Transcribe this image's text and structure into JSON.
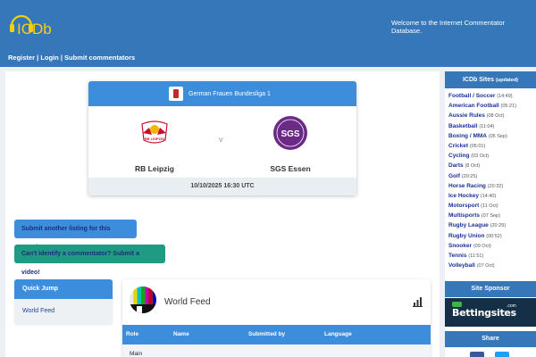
{
  "header": {
    "logo_text": "ICDb",
    "welcome": "Welcome to the Internet Commentator Database.",
    "nav": [
      "Register",
      "Login",
      "Submit commentators"
    ],
    "nav_sep": "|"
  },
  "match": {
    "competition": "German Frauen Bundesliga 1",
    "home_team": "RB Leipzig",
    "away_team": "SGS Essen",
    "vs": "V",
    "datetime": "10/10/2025 16:30 UTC",
    "home_crest_text": "RB LEIPZIG",
    "away_crest_text": "SGS"
  },
  "actions": {
    "submit_listing": "Submit another listing for this match",
    "cant_identify": "Can't identify a commentator? Submit a video!"
  },
  "quick_jump": {
    "title": "Quick Jump",
    "links": [
      "World Feed"
    ]
  },
  "feed": {
    "title": "World Feed",
    "columns": [
      "Role",
      "Name",
      "Submitted by",
      "Language"
    ],
    "rows": [
      {
        "role": "Main"
      }
    ]
  },
  "sidebar": {
    "sites_title": "ICDb Sites",
    "sites_title_note": "(updated)",
    "sites": [
      {
        "name": "Football / Soccer",
        "time": "(14:49)"
      },
      {
        "name": "American Football",
        "time": "(05:21)"
      },
      {
        "name": "Aussie Rules",
        "time": "(08 Oct)"
      },
      {
        "name": "Basketball",
        "time": "(11:04)"
      },
      {
        "name": "Boxing / MMA",
        "time": "(05 Sep)"
      },
      {
        "name": "Cricket",
        "time": "(05:01)"
      },
      {
        "name": "Cycling",
        "time": "(03 Oct)"
      },
      {
        "name": "Darts",
        "time": "(8 Oct)"
      },
      {
        "name": "Golf",
        "time": "(20:25)"
      },
      {
        "name": "Horse Racing",
        "time": "(20:32)"
      },
      {
        "name": "Ice Hockey",
        "time": "(14:40)"
      },
      {
        "name": "Motorsport",
        "time": "(11 Oct)"
      },
      {
        "name": "Multisports",
        "time": "(07 Sep)"
      },
      {
        "name": "Rugby League",
        "time": "(20:29)"
      },
      {
        "name": "Rugby Union",
        "time": "(00:52)"
      },
      {
        "name": "Snooker",
        "time": "(09 Oct)"
      },
      {
        "name": "Tennis",
        "time": "(11:51)"
      },
      {
        "name": "Volleyball",
        "time": "(07 Oct)"
      }
    ],
    "sponsor_title": "Site Sponsor",
    "sponsor_name": "Bettingsites",
    "sponsor_suffix": ".com",
    "share_title": "Share"
  },
  "colors": {
    "header_blue": "#3677b9",
    "accent_blue": "#3d8ddd",
    "teal": "#209a82",
    "link_navy": "#1b2f9b"
  }
}
